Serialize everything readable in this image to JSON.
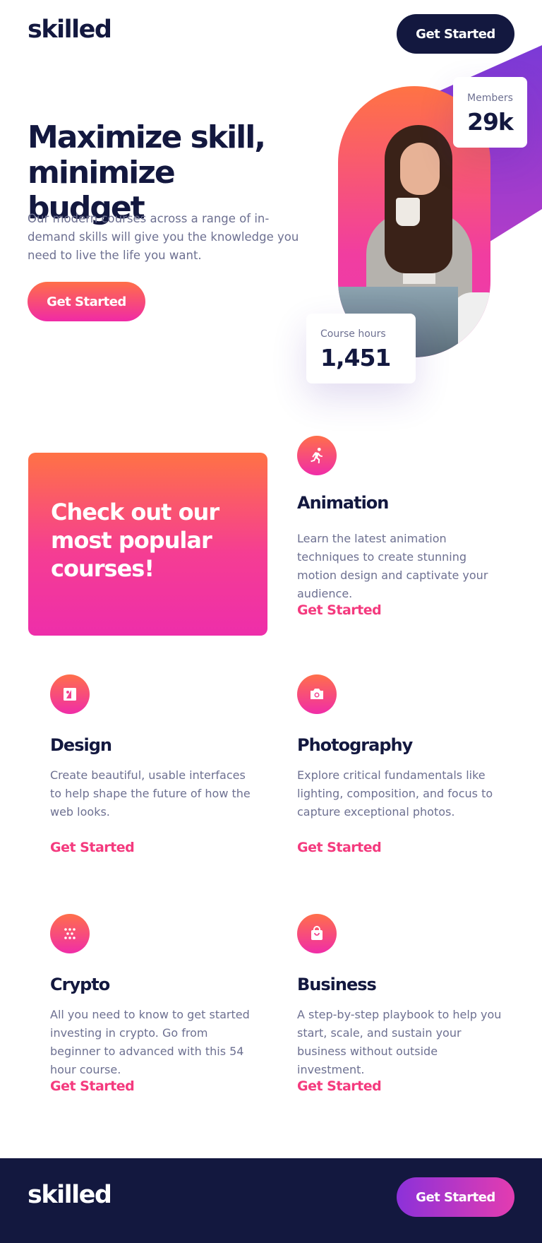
{
  "header": {
    "logo": "skilled",
    "cta_label": "Get Started"
  },
  "hero": {
    "title": "Maximize skill, minimize budget",
    "description": "Our modern courses across a range of in-demand skills will give you the knowledge you need to live the life you want.",
    "cta_label": "Get Started",
    "stats": {
      "members_label": "Members",
      "members_value": "29k",
      "hours_label": "Course hours",
      "hours_value": "1,451"
    }
  },
  "promo": {
    "text": "Check out our most popular courses!"
  },
  "courses": [
    {
      "icon": "running-person-icon",
      "title": "Animation",
      "description": "Learn the latest animation techniques to create stunning motion design and captivate your audience.",
      "link": "Get Started"
    },
    {
      "icon": "design-icon",
      "title": "Design",
      "description": "Create beautiful, usable interfaces to help shape the future of how the web looks.",
      "link": "Get Started"
    },
    {
      "icon": "camera-icon",
      "title": "Photography",
      "description": "Explore critical fundamentals like lighting, composition, and focus to capture exceptional photos.",
      "link": "Get Started"
    },
    {
      "icon": "crypto-icon",
      "title": "Crypto",
      "description": "All you need to know to get started investing in crypto. Go from beginner to advanced with this 54 hour course.",
      "link": "Get Started"
    },
    {
      "icon": "shopping-bag-icon",
      "title": "Business",
      "description": "A step-by-step playbook to help you start, scale, and sustain your business without outside investment.",
      "link": "Get Started"
    }
  ],
  "footer": {
    "logo": "skilled",
    "cta_label": "Get Started"
  },
  "colors": {
    "navy": "#13183f",
    "orange": "#ff6f48",
    "pink": "#f02aa6",
    "purple": "#8c31d9",
    "link": "#f43a7e",
    "muted": "#6d7091"
  }
}
